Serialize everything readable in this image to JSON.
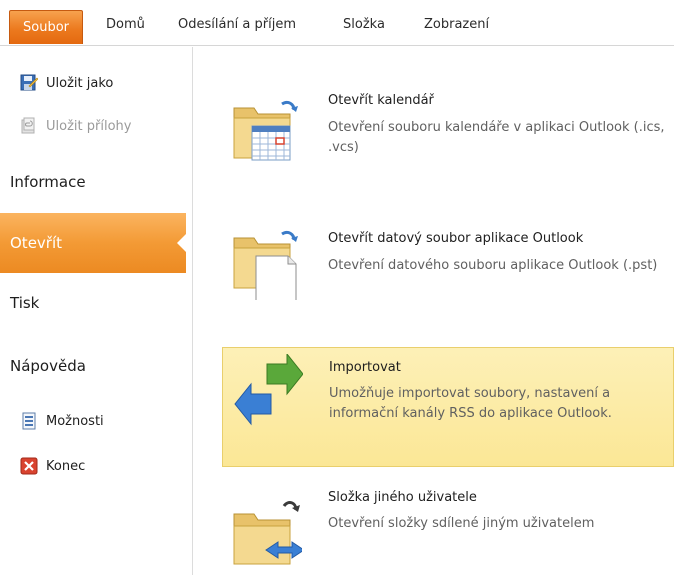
{
  "ribbon": {
    "tabs": [
      {
        "label": "Soubor"
      },
      {
        "label": "Domů"
      },
      {
        "label": "Odesílání a příjem"
      },
      {
        "label": "Složka"
      },
      {
        "label": "Zobrazení"
      }
    ]
  },
  "nav": {
    "save_as": "Uložit jako",
    "save_attachments": "Uložit přílohy",
    "info": "Informace",
    "open": "Otevřít",
    "print": "Tisk",
    "help": "Nápověda",
    "options": "Možnosti",
    "exit": "Konec"
  },
  "content": {
    "items": [
      {
        "title": "Otevřít kalendář",
        "desc": "Otevření souboru kalendáře v aplikaci Outlook (.ics, .vcs)",
        "icon": "calendar-folder-icon"
      },
      {
        "title": "Otevřít datový soubor aplikace Outlook",
        "desc": "Otevření datového souboru aplikace Outlook (.pst)",
        "icon": "data-file-folder-icon"
      },
      {
        "title": "Importovat",
        "desc": "Umožňuje importovat soubory, nastavení a informační kanály RSS do aplikace Outlook.",
        "icon": "import-arrows-icon"
      },
      {
        "title": "Složka jiného uživatele",
        "desc": "Otevření složky sdílené jiným uživatelem",
        "icon": "shared-folder-icon"
      }
    ]
  },
  "colors": {
    "file_tab": "#ec7a1f",
    "selected_nav": "#f39a35",
    "hover_item": "#fbe796"
  }
}
